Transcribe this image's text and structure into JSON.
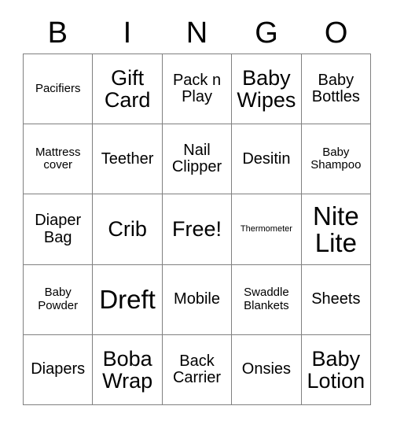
{
  "card": {
    "title": "BINGO",
    "headers": [
      "B",
      "I",
      "N",
      "G",
      "O"
    ],
    "free_space_label": "Free!",
    "colors": {
      "text": "#000000",
      "grid_line": "#808080",
      "background": "#ffffff"
    },
    "rows": [
      [
        {
          "text": "Pacifiers",
          "size": "sm"
        },
        {
          "text": "Gift Card",
          "size": "lg"
        },
        {
          "text": "Pack n Play",
          "size": "md"
        },
        {
          "text": "Baby Wipes",
          "size": "lg"
        },
        {
          "text": "Baby Bottles",
          "size": "md"
        }
      ],
      [
        {
          "text": "Mattress cover",
          "size": "sm"
        },
        {
          "text": "Teether",
          "size": "md"
        },
        {
          "text": "Nail Clipper",
          "size": "md"
        },
        {
          "text": "Desitin",
          "size": "md"
        },
        {
          "text": "Baby Shampoo",
          "size": "sm"
        }
      ],
      [
        {
          "text": "Diaper Bag",
          "size": "md"
        },
        {
          "text": "Crib",
          "size": "lg"
        },
        {
          "text": "Free!",
          "size": "lg"
        },
        {
          "text": "Thermometer",
          "size": "xs"
        },
        {
          "text": "Nite Lite",
          "size": "xl"
        }
      ],
      [
        {
          "text": "Baby Powder",
          "size": "sm"
        },
        {
          "text": "Dreft",
          "size": "xl"
        },
        {
          "text": "Mobile",
          "size": "md"
        },
        {
          "text": "Swaddle Blankets",
          "size": "sm"
        },
        {
          "text": "Sheets",
          "size": "md"
        }
      ],
      [
        {
          "text": "Diapers",
          "size": "md"
        },
        {
          "text": "Boba Wrap",
          "size": "lg"
        },
        {
          "text": "Back Carrier",
          "size": "md"
        },
        {
          "text": "Onsies",
          "size": "md"
        },
        {
          "text": "Baby Lotion",
          "size": "lg"
        }
      ]
    ]
  }
}
